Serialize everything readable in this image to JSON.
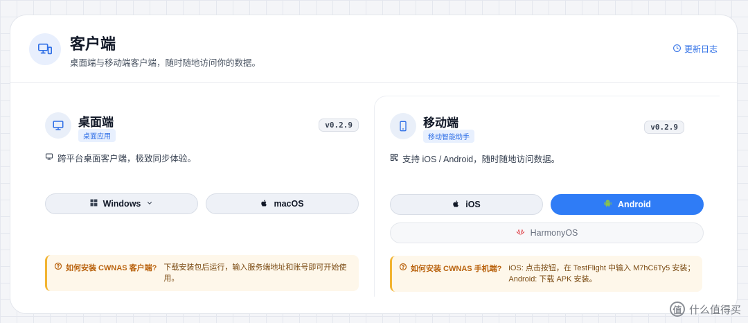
{
  "header": {
    "title": "客户端",
    "subtitle": "桌面端与移动端客户端，随时随地访问你的数据。",
    "changelog": "更新日志"
  },
  "desktop": {
    "title": "桌面端",
    "tag": "桌面应用",
    "version": "v0.2.9",
    "description": "跨平台桌面客户端，极致同步体验。",
    "buttons": {
      "windows": "Windows",
      "macos": "macOS"
    },
    "notice": {
      "question": "如何安装 CWNAS 客户端?",
      "answer": "下载安装包后运行，输入服务端地址和账号即可开始使用。"
    }
  },
  "mobile": {
    "title": "移动端",
    "tag": "移动智能助手",
    "version": "v0.2.9",
    "description": "支持 iOS / Android，随时随地访问数据。",
    "buttons": {
      "ios": "iOS",
      "android": "Android",
      "harmony": "HarmonyOS"
    },
    "notice": {
      "question": "如何安装 CWNAS 手机端?",
      "answer": "iOS: 点击按钮，在 TestFlight 中输入 M7hC6Ty5 安装；Android: 下载 APK 安装。"
    }
  },
  "watermark": {
    "text": "什么值得买",
    "symbol": "值"
  },
  "colors": {
    "accent": "#2f7cf6",
    "notice_bg": "#fef7ea",
    "notice_border": "#f2b431"
  }
}
